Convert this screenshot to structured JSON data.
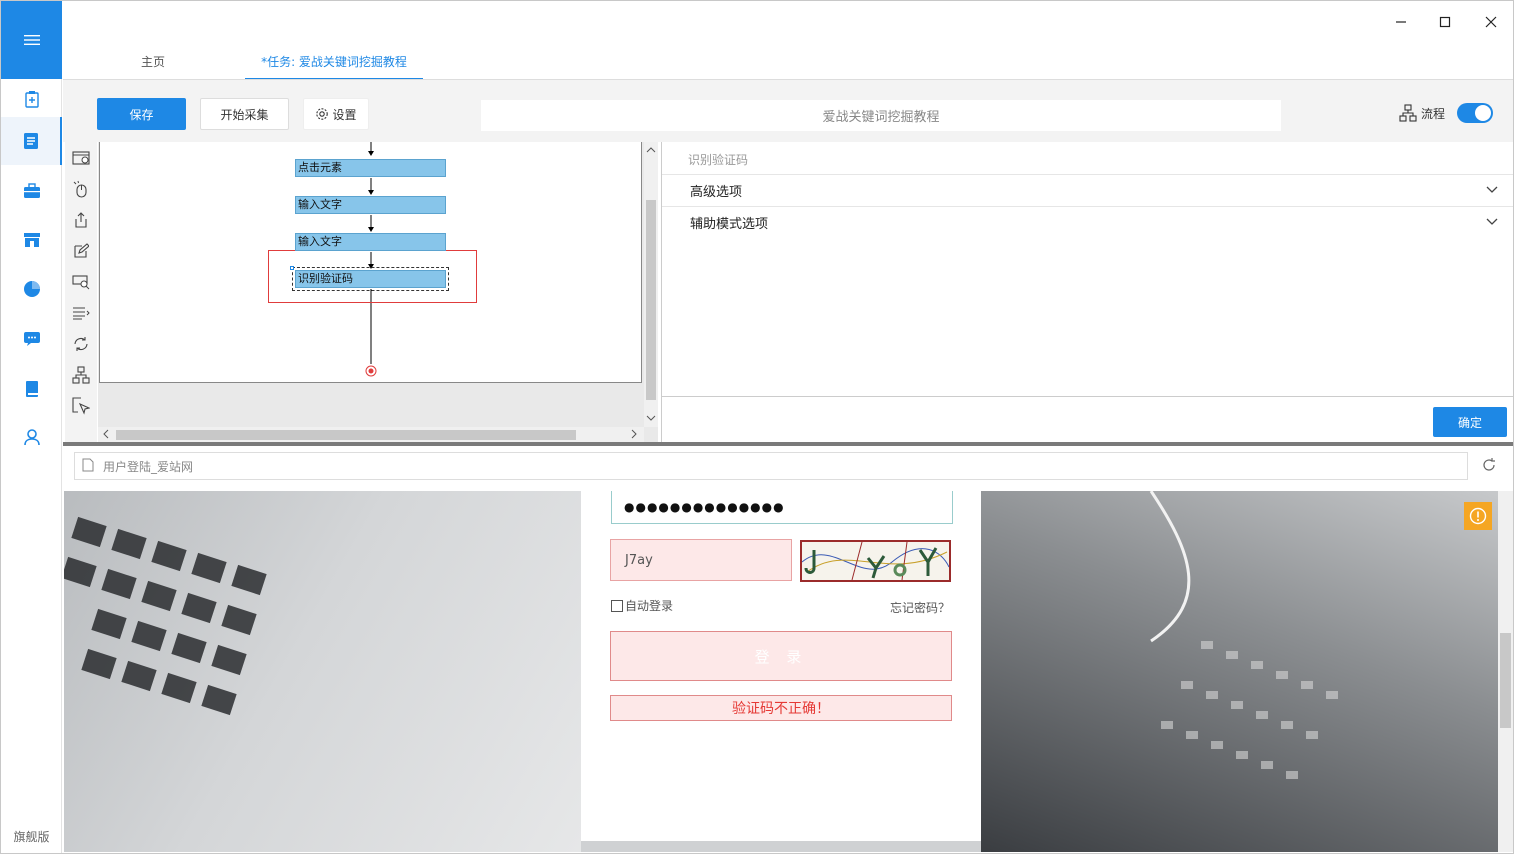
{
  "window": {
    "controls": [
      "minimize-icon",
      "maximize-icon",
      "close-icon"
    ]
  },
  "leftnav": {
    "items": [
      "clipboard-icon",
      "document-icon",
      "briefcase-icon",
      "store-icon",
      "pie-chart-icon",
      "message-icon",
      "book-icon",
      "user-icon"
    ],
    "edition": "旗舰版",
    "accent": "#1e88e5"
  },
  "tabs": [
    {
      "label": "主页"
    },
    {
      "label": "*任务: 爱战关键词挖掘教程"
    }
  ],
  "toolbar": {
    "save_label": "保存",
    "collect_label": "开始采集",
    "settings_label": "设置",
    "task_name": "爱战关键词挖掘教程",
    "flow_label": "流程",
    "flow_toggle_on": true
  },
  "tools": [
    "add-page-icon",
    "click-icon",
    "export-icon",
    "edit-icon",
    "captcha-icon",
    "list-icon",
    "loop-icon",
    "branch-icon",
    "cursor-icon"
  ],
  "flow": {
    "nodes": [
      {
        "label": "点击元素"
      },
      {
        "label": "输入文字"
      },
      {
        "label": "输入文字"
      },
      {
        "label": "识别验证码"
      }
    ],
    "selected": 3
  },
  "panel": {
    "title": "识别验证码",
    "sections": [
      {
        "label": "高级选项"
      },
      {
        "label": "辅助模式选项"
      }
    ],
    "ok_label": "确定"
  },
  "browser": {
    "address": "用户登陆_爱站网",
    "password_mask": "●●●●●●●●●●●●●●",
    "captcha_value": "J7ay",
    "auto_login_label": "自动登录",
    "forgot_label": "忘记密码？",
    "login_label": "登 录",
    "error_message": "验证码不正确！"
  }
}
